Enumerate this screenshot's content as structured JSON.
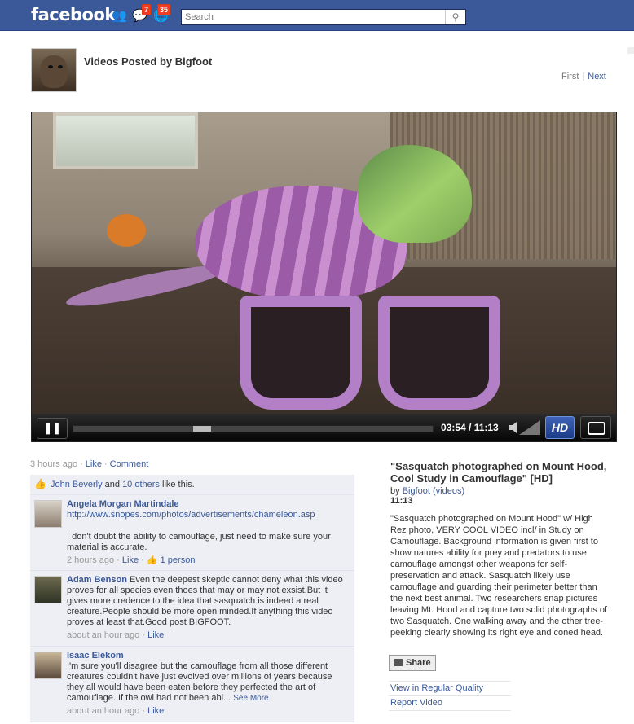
{
  "topbar": {
    "logo": "facebook",
    "friend_requests_badge": "",
    "messages_badge": "7",
    "notifications_badge": "35",
    "search_placeholder": "Search"
  },
  "header": {
    "title": "Videos Posted by Bigfoot",
    "pager_first": "First",
    "pager_next": "Next"
  },
  "player": {
    "time": "03:54 / 11:13",
    "hd_label": "HD",
    "progress": 0.35
  },
  "post": {
    "age": "3 hours ago",
    "like": "Like",
    "comment": "Comment",
    "likes": {
      "person": "John Beverly",
      "and": " and ",
      "others": "10 others",
      "suffix": " like this."
    }
  },
  "comments": [
    {
      "name": "Angela Morgan Martindale",
      "text_link": " http://www.snopes.com/photos/advertisements/chameleon.asp",
      "text": "I don't doubt the ability to camouflage, just need to make sure your material is accurate.",
      "time": "2 hours ago",
      "like": "Like",
      "likes": "1 person"
    },
    {
      "name": "Adam Benson",
      "text": " Even the deepest skeptic cannot deny what this video proves for all species even thoes that may or may not exsist.But it gives more credence to the idea that sasquatch is indeed a real creature.People should be more open minded.If anything this video proves at least that.Good post BIGFOOT.",
      "time": "about an hour ago",
      "like": "Like"
    },
    {
      "name": "Isaac Elekom",
      "text": "I'm sure you'll disagree but the camouflage from all those different creatures couldn't have just evolved over millions of years because they all would have been eaten before they perfected the art of camouflage. If the owl had not been abl...",
      "see_more": "See More",
      "time": "about an hour ago",
      "like": "Like"
    }
  ],
  "details": {
    "title": "\"Sasquatch photographed on Mount Hood, Cool Study in Camouflage\" [HD]",
    "by": "by ",
    "author": "Bigfoot",
    "videos_link": "(videos)",
    "duration": "11:13",
    "description": "\"Sasquatch photographed on Mount Hood\" w/ High Rez photo, VERY COOL VIDEO incl/ in Study on Camouflage. Background information is given first to show natures ability for prey and predators to use camouflage amongst other weapons for self-preservation and attack. Sasquatch likely use camouflage and guarding their perimeter better than the next best animal. Two researchers snap pictures leaving Mt. Hood and capture two solid photographs of two Sasquatch. One walking away and the other tree-peeking clearly showing its right eye and coned head.",
    "share": "Share",
    "regular_quality": "View in Regular Quality",
    "report": "Report Video"
  }
}
